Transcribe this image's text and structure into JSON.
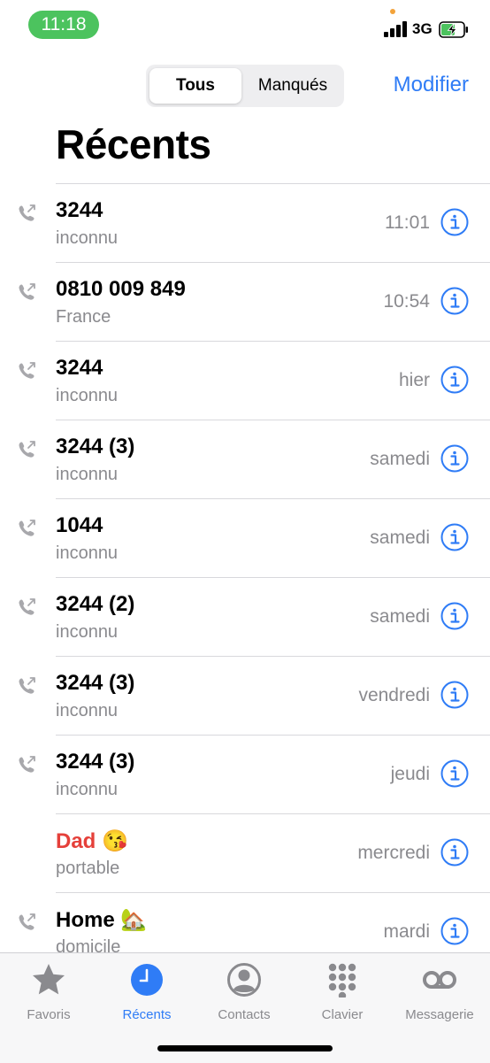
{
  "status_bar": {
    "time": "11:18",
    "network": "3G"
  },
  "segment": {
    "tabs": [
      "Tous",
      "Manqués"
    ],
    "selected": "Tous"
  },
  "header": {
    "edit_label": "Modifier",
    "title": "Récents"
  },
  "calls": [
    {
      "name": "3244",
      "label": "inconnu",
      "date": "11:01",
      "missed": false,
      "outgoing_icon": true
    },
    {
      "name": "0810 009 849",
      "label": "France",
      "date": "10:54",
      "missed": false,
      "outgoing_icon": true
    },
    {
      "name": "3244",
      "label": "inconnu",
      "date": "hier",
      "missed": false,
      "outgoing_icon": true
    },
    {
      "name": "3244 (3)",
      "label": "inconnu",
      "date": "samedi",
      "missed": false,
      "outgoing_icon": true
    },
    {
      "name": "1044",
      "label": "inconnu",
      "date": "samedi",
      "missed": false,
      "outgoing_icon": true
    },
    {
      "name": "3244 (2)",
      "label": "inconnu",
      "date": "samedi",
      "missed": false,
      "outgoing_icon": true
    },
    {
      "name": "3244 (3)",
      "label": "inconnu",
      "date": "vendredi",
      "missed": false,
      "outgoing_icon": true
    },
    {
      "name": "3244 (3)",
      "label": "inconnu",
      "date": "jeudi",
      "missed": false,
      "outgoing_icon": true
    },
    {
      "name": "Dad 😘",
      "label": "portable",
      "date": "mercredi",
      "missed": true,
      "outgoing_icon": false
    },
    {
      "name": "Home 🏡",
      "label": "domicile",
      "date": "mardi",
      "missed": false,
      "outgoing_icon": true
    }
  ],
  "tabbar": {
    "items": [
      {
        "label": "Favoris",
        "icon": "star-icon"
      },
      {
        "label": "Récents",
        "icon": "clock-icon"
      },
      {
        "label": "Contacts",
        "icon": "person-circle-icon"
      },
      {
        "label": "Clavier",
        "icon": "keypad-icon"
      },
      {
        "label": "Messagerie",
        "icon": "voicemail-icon"
      }
    ],
    "active": "Récents"
  },
  "colors": {
    "accent": "#2f7cf6",
    "missed": "#e5403a",
    "secondary_text": "#8a8a8e",
    "time_pill": "#4cc35e"
  }
}
